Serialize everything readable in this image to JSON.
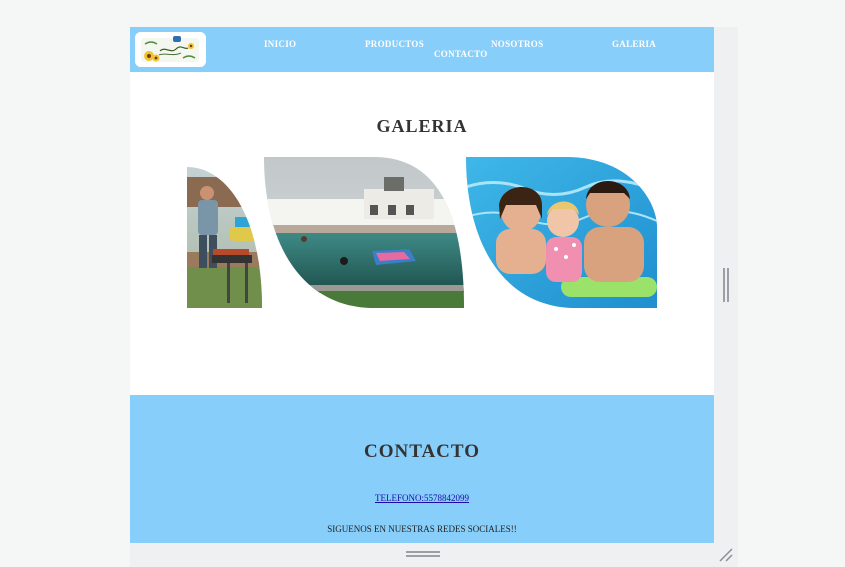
{
  "nav": {
    "links": [
      "INICIO",
      "PRODUCTOS",
      "NOSOTROS",
      "GALERIA",
      "CONTACTO"
    ]
  },
  "gallery": {
    "title": "GALERIA",
    "images": [
      "man-grilling-photo",
      "pool-photo",
      "family-pool-photo"
    ]
  },
  "contact": {
    "title": "CONTACTO",
    "phone": "TELEFONO:5578842099",
    "social": "SIGUENOS EN NUESTRAS REDES SOCIALES!!"
  },
  "colors": {
    "navbar": "#87cefa",
    "contact_bg": "#87cefa",
    "title_text": "#333333"
  }
}
